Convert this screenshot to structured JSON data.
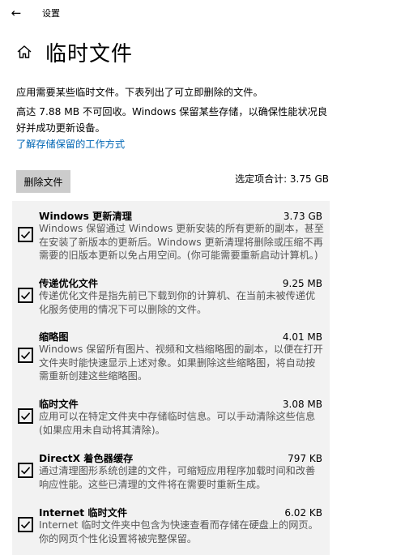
{
  "window": {
    "title": "设置",
    "back_icon": "back-arrow-icon"
  },
  "header": {
    "title": "临时文件",
    "icon": "home-icon"
  },
  "description": {
    "line1": "应用需要某些临时文件。下表列出了可立即删除的文件。",
    "line2": "高达 7.88 MB 不可回收。Windows 保留某些存储，以确保性能状况良好并成功更新设备。"
  },
  "learn_link": "了解存储保留的工作方式",
  "toolbar": {
    "remove_label": "删除文件",
    "selected_total": "选定项合计: 3.75 GB"
  },
  "items": [
    {
      "name": "Windows 更新清理",
      "size": "3.73 GB",
      "checked": true,
      "description": "Windows 保留通过 Windows 更新安装的所有更新的副本，甚至在安装了新版本的更新后。Windows 更新清理将删除或压缩不再需要的旧版本更新以免占用空间。(你可能需要重新启动计算机。)"
    },
    {
      "name": "传递优化文件",
      "size": "9.25 MB",
      "checked": true,
      "description": "传递优化文件是指先前已下载到你的计算机、在当前未被传递优化服务使用的情况下可以删除的文件。"
    },
    {
      "name": "缩略图",
      "size": "4.01 MB",
      "checked": true,
      "description": "Windows 保留所有图片、视频和文档缩略图的副本，以便在打开文件夹时能快速显示上述对象。如果删除这些缩略图，将自动按需重新创建这些缩略图。"
    },
    {
      "name": "临时文件",
      "size": "3.08 MB",
      "checked": true,
      "description": "应用可以在特定文件夹中存储临时信息。可以手动清除这些信息(如果应用未自动将其清除)。"
    },
    {
      "name": "DirectX 着色器缓存",
      "size": "797 KB",
      "checked": true,
      "description": "通过清理图形系统创建的文件，可缩短应用程序加载时间和改善响应性能。这些已清理的文件将在需要时重新生成。"
    },
    {
      "name": "Internet 临时文件",
      "size": "6.02 KB",
      "checked": true,
      "description": "Internet 临时文件夹中包含为快速查看而存储在硬盘上的网页。你的网页个性化设置将被完整保留。"
    }
  ],
  "colors": {
    "accent_link": "#0066b4",
    "list_bg": "#f2f2f2",
    "button_bg": "#cccccc"
  }
}
